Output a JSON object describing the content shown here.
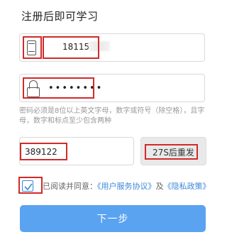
{
  "title": "注册后即可学习",
  "phone": {
    "value": "18115"
  },
  "password": {
    "value": "••••••••"
  },
  "hint": "密码必须是8位以上英文字母，数字或符号（除空格），且字母，数字和标点至少包含两种",
  "code": {
    "value": "389122",
    "resend_label": "27S后重发"
  },
  "agree": {
    "checked": true,
    "prefix": "已阅读并同意：",
    "terms": "《用户服务协议》",
    "and": "及",
    "privacy": "《隐私政策》"
  },
  "next_label": "下一步",
  "colors": {
    "accent": "#3b87d9",
    "button": "#5aa3f0",
    "annotation": "#d22a2a"
  },
  "icons": [
    "phone-icon",
    "lock-icon",
    "checkmark-icon"
  ]
}
